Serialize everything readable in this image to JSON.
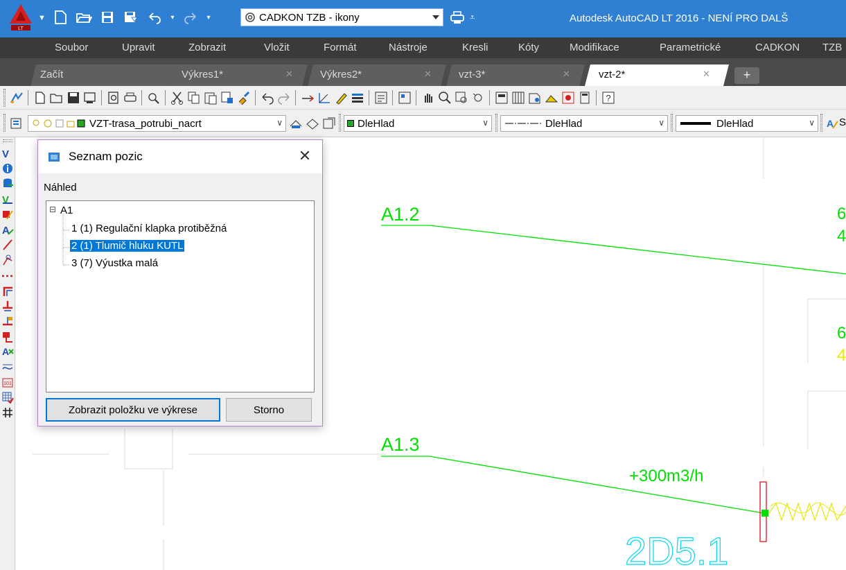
{
  "app": {
    "logo_text": "LT",
    "workspace": "CADKON TZB - ikony",
    "title": "Autodesk AutoCAD LT 2016 - NENÍ PRO DALŠ"
  },
  "menu": [
    "Soubor",
    "Upravit",
    "Zobrazit",
    "Vložit",
    "Formát",
    "Nástroje",
    "Kresli",
    "Kóty",
    "Modifikace",
    "Parametrické",
    "CADKON",
    "TZB"
  ],
  "tabs": [
    {
      "label": "Začít",
      "closable": false
    },
    {
      "label": "Výkres1*",
      "closable": true
    },
    {
      "label": "Výkres2*",
      "closable": true
    },
    {
      "label": "vzt-3*",
      "closable": true
    },
    {
      "label": "vzt-2*",
      "closable": true,
      "active": true
    }
  ],
  "tab_close_glyph": "✕",
  "tab_new_glyph": "+",
  "layers": {
    "current_layer": "VZT-trasa_potrubi_nacrt",
    "color": "DleHlad",
    "linetype": "DleHlad",
    "lineweight": "DleHlad",
    "truncated_label": "S"
  },
  "dialog": {
    "title": "Seznam pozic",
    "close_glyph": "✕",
    "preview_label": "Náhled",
    "tree": {
      "expander": "⊟",
      "root": "A1",
      "items": [
        "1 (1) Regulační klapka protiběžná",
        "2 (1) Tlumič hluku KUTL",
        "3 (7) Výustka malá"
      ],
      "selected_index": 1
    },
    "buttons": {
      "show": "Zobrazit položku ve výkrese",
      "cancel": "Storno"
    }
  },
  "drawing": {
    "labels": {
      "a12": "A1.2",
      "a13": "A1.3",
      "flow": "+300m3/h",
      "room": "2D5.1",
      "edge1a": "6",
      "edge1b": "4",
      "edge2a": "6",
      "edge2b": "4"
    }
  },
  "colors": {
    "titlebar": "#2f80d3",
    "menubar": "#3a3a3a",
    "tabbar": "#4b4b4b",
    "pipe_green": "#00e000",
    "room_cyan": "#00d8f0",
    "fitting_red": "#e00000",
    "spiral_yellow": "#e8e800",
    "selection": "#0078d7"
  }
}
